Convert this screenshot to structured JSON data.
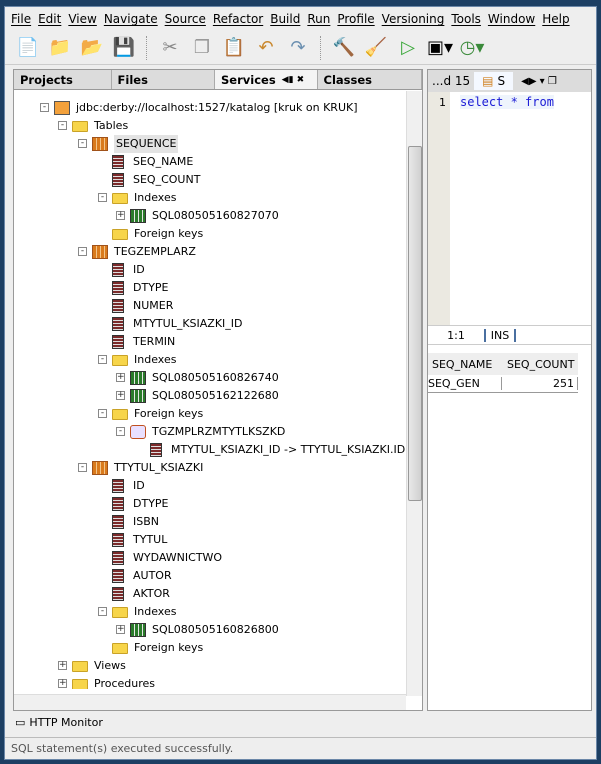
{
  "menu": [
    "File",
    "Edit",
    "View",
    "Navigate",
    "Source",
    "Refactor",
    "Build",
    "Run",
    "Profile",
    "Versioning",
    "Tools",
    "Window",
    "Help"
  ],
  "toolbar": [
    "new-file-icon",
    "new-project-icon",
    "open-project-icon",
    "save-all-icon",
    "cut-icon",
    "copy-icon",
    "paste-icon",
    "undo-icon",
    "redo-icon",
    "build-icon",
    "clean-build-icon",
    "run-icon",
    "debug-icon",
    "profile-icon"
  ],
  "left_tabs": [
    "Projects",
    "Files",
    "Services",
    "Classes"
  ],
  "active_tab": "Services",
  "tree": [
    {
      "level": 0,
      "type": "conn",
      "label": "jdbc:derby://localhost:1527/katalog [kruk on KRUK]",
      "exp": "-"
    },
    {
      "level": 1,
      "type": "folder",
      "label": "Tables",
      "exp": "-"
    },
    {
      "level": 2,
      "type": "table",
      "label": "SEQUENCE",
      "exp": "-",
      "selected": true
    },
    {
      "level": 3,
      "type": "col",
      "label": "SEQ_NAME"
    },
    {
      "level": 3,
      "type": "col",
      "label": "SEQ_COUNT"
    },
    {
      "level": 3,
      "type": "folder",
      "label": "Indexes",
      "exp": "-"
    },
    {
      "level": 4,
      "type": "idx",
      "label": "SQL080505160827070",
      "exp": "+"
    },
    {
      "level": 3,
      "type": "folder",
      "label": "Foreign keys"
    },
    {
      "level": 2,
      "type": "table",
      "label": "TEGZEMPLARZ",
      "exp": "-"
    },
    {
      "level": 3,
      "type": "col",
      "label": "ID"
    },
    {
      "level": 3,
      "type": "col",
      "label": "DTYPE"
    },
    {
      "level": 3,
      "type": "col",
      "label": "NUMER"
    },
    {
      "level": 3,
      "type": "col",
      "label": "MTYTUL_KSIAZKI_ID"
    },
    {
      "level": 3,
      "type": "col",
      "label": "TERMIN"
    },
    {
      "level": 3,
      "type": "folder",
      "label": "Indexes",
      "exp": "-"
    },
    {
      "level": 4,
      "type": "idx",
      "label": "SQL080505160826740",
      "exp": "+"
    },
    {
      "level": 4,
      "type": "idx",
      "label": "SQL080505162122680",
      "exp": "+"
    },
    {
      "level": 3,
      "type": "folder",
      "label": "Foreign keys",
      "exp": "-"
    },
    {
      "level": 4,
      "type": "fk",
      "label": "TGZMPLRZMTYTLKSZKD",
      "exp": "-"
    },
    {
      "level": 5,
      "type": "col",
      "label": "MTYTUL_KSIAZKI_ID -> TTYTUL_KSIAZKI.ID"
    },
    {
      "level": 2,
      "type": "table",
      "label": "TTYTUL_KSIAZKI",
      "exp": "-"
    },
    {
      "level": 3,
      "type": "col",
      "label": "ID"
    },
    {
      "level": 3,
      "type": "col",
      "label": "DTYPE"
    },
    {
      "level": 3,
      "type": "col",
      "label": "ISBN"
    },
    {
      "level": 3,
      "type": "col",
      "label": "TYTUL"
    },
    {
      "level": 3,
      "type": "col",
      "label": "WYDAWNICTWO"
    },
    {
      "level": 3,
      "type": "col",
      "label": "AUTOR"
    },
    {
      "level": 3,
      "type": "col",
      "label": "AKTOR"
    },
    {
      "level": 3,
      "type": "folder",
      "label": "Indexes",
      "exp": "-"
    },
    {
      "level": 4,
      "type": "idx",
      "label": "SQL080505160826800",
      "exp": "+"
    },
    {
      "level": 3,
      "type": "folder",
      "label": "Foreign keys"
    },
    {
      "level": 1,
      "type": "folder",
      "label": "Views",
      "exp": "+"
    },
    {
      "level": 1,
      "type": "folder",
      "label": "Procedures",
      "exp": "+"
    }
  ],
  "editor": {
    "tab_prev": "...d 15",
    "tab_active": "S",
    "line_no": "1",
    "code": "select * from",
    "position": "1:1",
    "mode": "INS"
  },
  "results": {
    "columns": [
      "SEQ_NAME",
      "SEQ_COUNT"
    ],
    "rows": [
      [
        "SEQ_GEN",
        "251"
      ]
    ]
  },
  "bottom": {
    "http_monitor": "HTTP Monitor"
  },
  "status": "SQL statement(s) executed successfully."
}
